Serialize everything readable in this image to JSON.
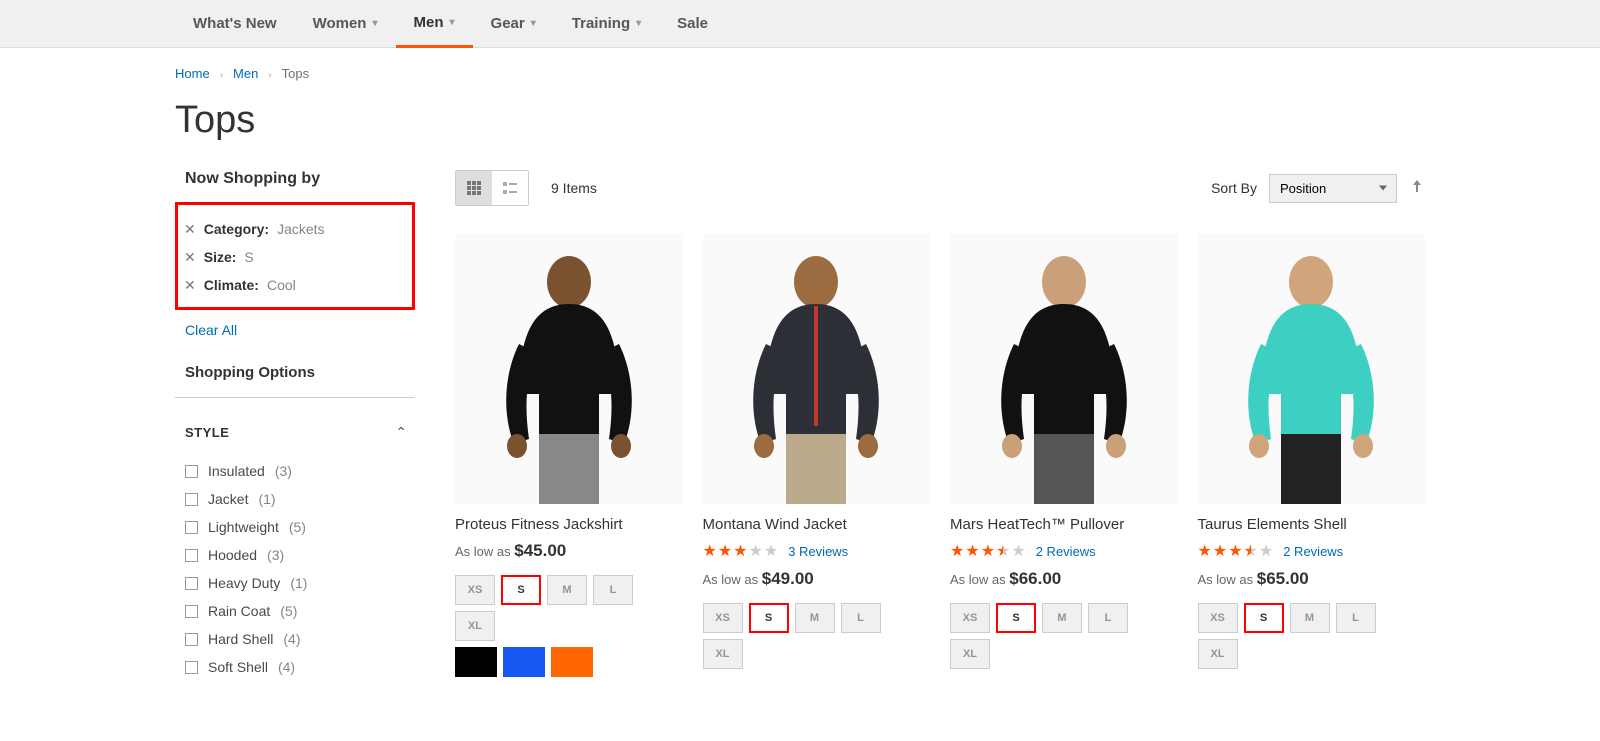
{
  "nav": {
    "items": [
      {
        "label": "What's New",
        "dropdown": false
      },
      {
        "label": "Women",
        "dropdown": true
      },
      {
        "label": "Men",
        "dropdown": true,
        "active": true
      },
      {
        "label": "Gear",
        "dropdown": true
      },
      {
        "label": "Training",
        "dropdown": true
      },
      {
        "label": "Sale",
        "dropdown": false
      }
    ]
  },
  "breadcrumb": {
    "items": [
      {
        "label": "Home",
        "link": true
      },
      {
        "label": "Men",
        "link": true
      },
      {
        "label": "Tops",
        "link": false
      }
    ]
  },
  "page_title": "Tops",
  "sidebar": {
    "now_shopping_title": "Now Shopping by",
    "applied_filters": [
      {
        "label": "Category:",
        "value": "Jackets"
      },
      {
        "label": "Size:",
        "value": "S"
      },
      {
        "label": "Climate:",
        "value": "Cool"
      }
    ],
    "clear_all": "Clear All",
    "shopping_options_title": "Shopping Options",
    "style_group": {
      "title": "STYLE",
      "options": [
        {
          "label": "Insulated",
          "count": "(3)"
        },
        {
          "label": "Jacket",
          "count": "(1)"
        },
        {
          "label": "Lightweight",
          "count": "(5)"
        },
        {
          "label": "Hooded",
          "count": "(3)"
        },
        {
          "label": "Heavy Duty",
          "count": "(1)"
        },
        {
          "label": "Rain Coat",
          "count": "(5)"
        },
        {
          "label": "Hard Shell",
          "count": "(4)"
        },
        {
          "label": "Soft Shell",
          "count": "(4)"
        }
      ]
    }
  },
  "toolbar": {
    "item_count": "9 Items",
    "sort_label": "Sort By",
    "sort_value": "Position"
  },
  "products": [
    {
      "name": "Proteus Fitness Jackshirt",
      "low_as": "As low as",
      "price": "$45.00",
      "reviews": null,
      "rating": 0,
      "sizes": [
        "XS",
        "S",
        "M",
        "L",
        "XL"
      ],
      "selected_size_idx": 1,
      "colors": [
        "#000000",
        "#1857f0",
        "#ff6600"
      ]
    },
    {
      "name": "Montana Wind Jacket",
      "low_as": "As low as",
      "price": "$49.00",
      "reviews": "3 Reviews",
      "rating": 3,
      "sizes": [
        "XS",
        "S",
        "M",
        "L",
        "XL"
      ],
      "selected_size_idx": 1,
      "colors": []
    },
    {
      "name": "Mars HeatTech™ Pullover",
      "low_as": "As low as",
      "price": "$66.00",
      "reviews": "2 Reviews",
      "rating": 3.5,
      "sizes": [
        "XS",
        "S",
        "M",
        "L",
        "XL"
      ],
      "selected_size_idx": 1,
      "colors": []
    },
    {
      "name": "Taurus Elements Shell",
      "low_as": "As low as",
      "price": "$65.00",
      "reviews": "2 Reviews",
      "rating": 3.5,
      "sizes": [
        "XS",
        "S",
        "M",
        "L",
        "XL"
      ],
      "selected_size_idx": 1,
      "colors": []
    }
  ],
  "product_visuals": [
    {
      "skin": "#7a5230",
      "top": "#111",
      "bottom": "#888"
    },
    {
      "skin": "#9c6b3f",
      "top": "#2c2f36",
      "bottom": "#bba98c",
      "zip": "#c0392b"
    },
    {
      "skin": "#caa07a",
      "top": "#111",
      "bottom": "#555"
    },
    {
      "skin": "#d1a57c",
      "top": "#3ecfc3",
      "bottom": "#222"
    }
  ]
}
